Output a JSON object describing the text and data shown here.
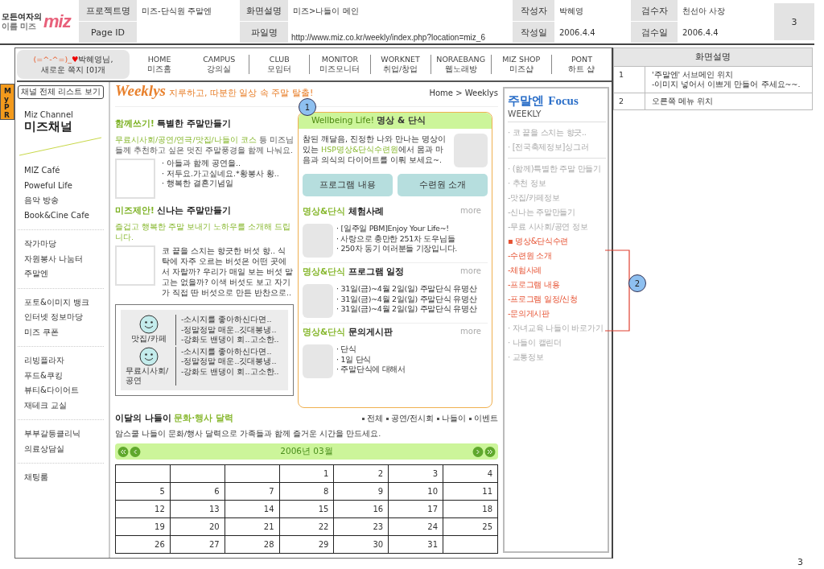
{
  "header": {
    "logo": {
      "caption_top": "모든여자의",
      "caption_bottom": "이름 미즈",
      "word": "miz"
    },
    "rows": [
      [
        {
          "label": "프로젝트명",
          "value": "미즈-단식원 주말엔"
        },
        {
          "label": "화면설명",
          "value": "미즈>나들이 메인"
        },
        {
          "label": "작성자",
          "value": "박혜영"
        },
        {
          "label": "검수자",
          "value": "천선아 사장"
        }
      ],
      [
        {
          "label": "Page ID"
        },
        {
          "label": "파일명",
          "value": "http://www.miz.co.kr/weekly/index.php?location=miz_6"
        },
        {
          "label": "작성일",
          "value": "2006.4.4"
        },
        {
          "label": "검수일",
          "value": "2006.4.4"
        }
      ]
    ],
    "page_no": "3"
  },
  "user_box": {
    "emoticon": "(=^-^=)_",
    "heart": "♥",
    "greeting": "박혜영님,",
    "message": "새로운 쪽지 [0]개"
  },
  "nav": [
    {
      "en": "HOME",
      "ko": "미즈홈"
    },
    {
      "en": "CAMPUS",
      "ko": "강의실"
    },
    {
      "en": "CLUB",
      "ko": "모임터"
    },
    {
      "en": "MONITOR",
      "ko": "미즈모니터"
    },
    {
      "en": "WORKNET",
      "ko": "취업/창업"
    },
    {
      "en": "NORAEBANG",
      "ko": "웹노래방"
    },
    {
      "en": "MIZ SHOP",
      "ko": "미즈샵"
    },
    {
      "en": "PONT",
      "ko": "하트 샵"
    }
  ],
  "my_pr": "My PR",
  "sidebar": {
    "list_button": "채널 전체 리스트 보기",
    "channel_en": "Miz Channel",
    "channel_ko": "미즈채널",
    "groups": [
      [
        "MIZ Café",
        "Poweful Life",
        "음악 방송",
        "Book&Cine Cafe"
      ],
      [
        "작가마당",
        "자원봉사 나눔터",
        "주말엔"
      ],
      [
        "포토&이미지 뱅크",
        "인터넷 정보마당",
        "미즈 쿠폰"
      ],
      [
        "리빙플라자",
        "푸드&쿠킹",
        "뷰티&다이어트",
        "재테크 교실"
      ],
      [
        "부부갈등클리닉",
        "의료상담실"
      ],
      [
        "채팅룸"
      ]
    ]
  },
  "weeklys": {
    "brand": "Weeklys",
    "tagline": "지루하고, 따분한 일상 속 주말 탈출!",
    "breadcrumb": "Home > Weeklys"
  },
  "features": [
    {
      "accent": "함께쓰기!",
      "title": "특별한 주말만들기",
      "desc_accent": "무료시사회/공연/연극/맛집/나들이 코스",
      "desc": " 등 미즈님들께 추천하고 싶은 멋진 주말풍경을 함께 나눠요.",
      "lines": [
        "· 아들과 함께 공연을..",
        "· 저두요.가고싶네요.*황봉사 황..",
        "· 행복한 결혼기념일"
      ]
    },
    {
      "accent": "미즈제안!",
      "title": "신나는 주말만들기",
      "desc_accent": "즐겁고 행복한 주말 보내기 노하우를 소개해 드립니다.",
      "text": "코 끝을 스치는 향긋한 버섯 향.. 식탁에 자주 오르는 버섯은 어떤 곳에서 자랄까? 우리가 매일 보는 버섯 말고는 없을까? 이색 버섯도 보고 자기가 직접 딴 버섯으로 만든 반찬으로.."
    }
  ],
  "picks": [
    {
      "label": "맛집/카페",
      "lines": [
        "-소시지를 좋아하신다면..",
        "-정말정말 매운..깃대봉냉..",
        "-강화도 밴댕이 회..고소한.."
      ]
    },
    {
      "label": "무료시사회/공연",
      "lines": [
        "-소시지를 좋아하신다면..",
        "-정말정말 매운..깃대봉냉..",
        "-강화도 밴댕이 회..고소한.."
      ]
    }
  ],
  "wellbeing": {
    "accent": "Wellbeing Life!",
    "title": "명상 & 단식",
    "intro": "참된 깨달음, 진정한 나와 만나는 명상이 있는 ",
    "intro_accent": "HSP명상&단식수련원",
    "intro_rest": "에서 몸과 마음과 의식의 다이어트를 이뤄 보세요~.",
    "buttons": [
      "프로그램 내용",
      "수련원 소개"
    ],
    "sections": [
      {
        "accent": "명상&단식",
        "title": "체험사례",
        "more": "more",
        "lines": [
          "· [일주일 PBM]Enjoy Your Life~!",
          "· 사랑으로 충만한 251차 도우님들",
          "· 250차 동기 여러분들 기장입니다."
        ]
      },
      {
        "accent": "명상&단식",
        "title": "프로그램 일정",
        "more": "more",
        "lines": [
          "· 31일(금)~4월 2일(일) 주말단식 유명산",
          "· 31일(금)~4월 2일(일) 주말단식 유명산",
          "· 31일(금)~4월 2일(일) 주말단식 유명산"
        ]
      },
      {
        "accent": "명상&단식",
        "title": "문의게시판",
        "more": "more",
        "lines": [
          "· 단식",
          "· 1일 단식",
          "· 주말단식에 대해서"
        ]
      }
    ]
  },
  "calendar": {
    "title": "이달의 나들이",
    "title_accent": "문화·행사 달력",
    "filters": [
      "전체",
      "공연/전시회",
      "나들이",
      "이벤트"
    ],
    "desc": "암스쿨 나들이 문화/행사 달력으로 가족들과 함께 즐거운 시간을 만드세요.",
    "month": "2006년 03월",
    "rows": [
      [
        null,
        null,
        null,
        "1",
        "2",
        "3",
        "4"
      ],
      [
        "5",
        "6",
        "7",
        "8",
        "9",
        "10",
        "11"
      ],
      [
        "12",
        "13",
        "14",
        "15",
        "16",
        "17",
        "18"
      ],
      [
        "19",
        "20",
        "21",
        "22",
        "23",
        "24",
        "25"
      ],
      [
        "26",
        "27",
        "28",
        "29",
        "30",
        "31",
        null
      ]
    ]
  },
  "focus": {
    "title": "주말엔",
    "title_en": "Focus",
    "subtitle": "WEEKLY",
    "top_items": [
      "· 코 끝을 스치는 향긋..",
      "· [전국축제정보]싱그러"
    ],
    "items": [
      {
        "text": "· (함께)특별한 주말 만들기",
        "highlight": false
      },
      {
        "text": "· 추천 정보",
        "highlight": false
      },
      {
        "text": "-맛집/카페정보",
        "highlight": false
      },
      {
        "text": "-신나는 주말만들기",
        "highlight": false
      },
      {
        "text": "-무료 시사회/공연 정보",
        "highlight": false
      },
      {
        "text": "▪ 명상&단식수련",
        "highlight": true
      },
      {
        "text": "-수련원 소개",
        "highlight": true
      },
      {
        "text": "-체험사례",
        "highlight": true
      },
      {
        "text": "-프로그램 내용",
        "highlight": true
      },
      {
        "text": "-프로그램 일정/신청",
        "highlight": true
      },
      {
        "text": "-문의게시판",
        "highlight": true
      },
      {
        "text": "· 자녀교육 나들이 바로가기",
        "highlight": false
      },
      {
        "text": "· 나들이 캘린더",
        "highlight": false
      },
      {
        "text": "· 교통정보",
        "highlight": false
      }
    ]
  },
  "description": {
    "title": "화면설명",
    "rows": [
      {
        "no": "1",
        "lines": [
          "'주말엔' 서브메인 위치",
          "-이미지 넣어서 이쁘게 만들어 주세요~~."
        ]
      },
      {
        "no": "2",
        "lines": [
          "오른쪽 메뉴 위치"
        ]
      }
    ]
  },
  "callouts": [
    "1",
    "2"
  ],
  "footer_page": "3"
}
